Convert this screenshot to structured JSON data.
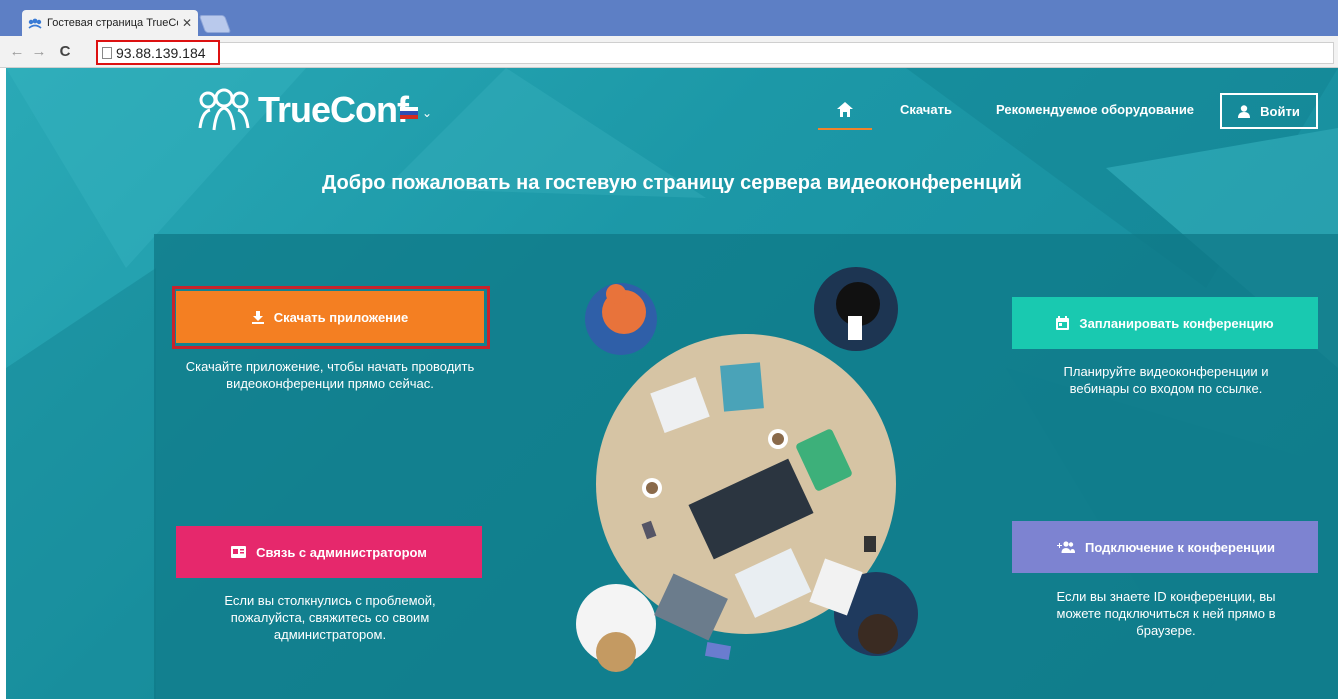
{
  "browser": {
    "tab_title": "Гостевая страница TrueCor",
    "tab_close": "✕",
    "url": "93.88.139.184"
  },
  "header": {
    "logo_text": "TrueConf",
    "lang_chevron": "⌄",
    "nav_download": "Скачать",
    "nav_equipment": "Рекомендуемое оборудование",
    "login_label": "Войти"
  },
  "main": {
    "welcome": "Добро пожаловать на гостевую страницу сервера видеоконференций",
    "download": {
      "label": "Скачать приложение",
      "desc": "Скачайте приложение, чтобы начать проводить видеоконференции прямо сейчас."
    },
    "schedule": {
      "label": "Запланировать конференцию",
      "desc": "Планируйте видеоконференции и вебинары со входом по ссылке."
    },
    "admin": {
      "label": "Связь с администратором",
      "desc": "Если вы столкнулись с проблемой, пожалуйста, свяжитесь со своим администратором."
    },
    "join": {
      "label": "Подключение к конференции",
      "desc": "Если вы знаете ID конференции, вы можете подключиться к ней прямо в браузере."
    }
  },
  "colors": {
    "background": "#1c98a7",
    "download": "#f47f22",
    "schedule": "#19c9b0",
    "admin": "#e6286c",
    "join": "#7d83d1",
    "highlight": "#c8232c"
  }
}
